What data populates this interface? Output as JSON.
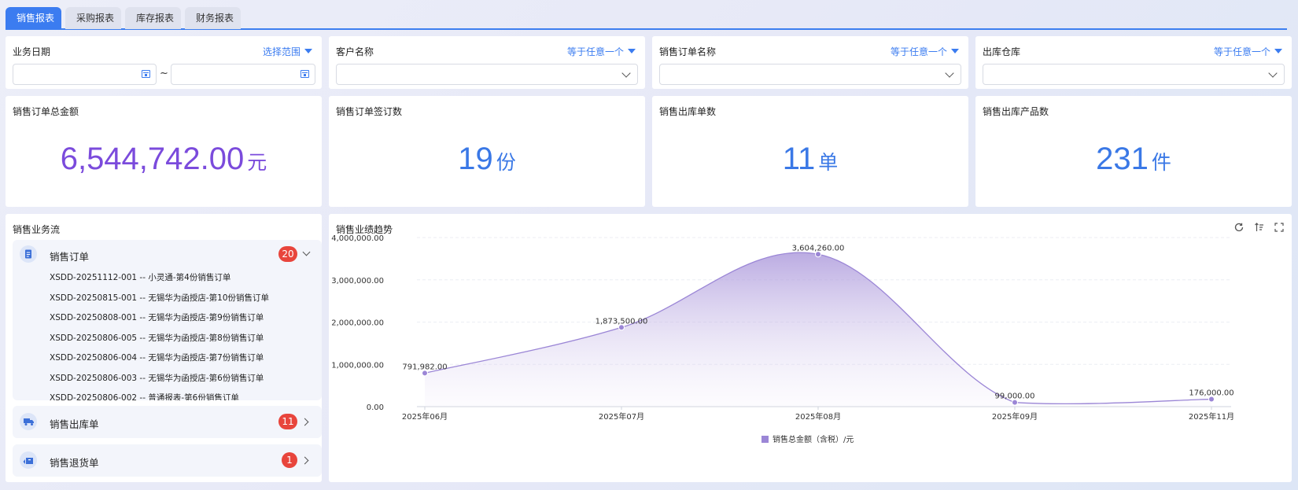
{
  "tabs": [
    {
      "label": "销售报表",
      "active": true
    },
    {
      "label": "采购报表",
      "active": false
    },
    {
      "label": "库存报表",
      "active": false
    },
    {
      "label": "财务报表",
      "active": false
    }
  ],
  "filters": {
    "date": {
      "label": "业务日期",
      "action": "选择范围",
      "start_value": "",
      "end_value": "",
      "separator": "~"
    },
    "customer": {
      "label": "客户名称",
      "action": "等于任意一个",
      "value": ""
    },
    "order_name": {
      "label": "销售订单名称",
      "action": "等于任意一个",
      "value": ""
    },
    "warehouse": {
      "label": "出库仓库",
      "action": "等于任意一个",
      "value": ""
    }
  },
  "kpis": [
    {
      "title": "销售订单总金额",
      "value": "6,544,742.00",
      "unit": "元",
      "color": "#7b4bdc"
    },
    {
      "title": "销售订单签订数",
      "value": "19",
      "unit": "份",
      "color": "#3a78e6"
    },
    {
      "title": "销售出库单数",
      "value": "11",
      "unit": "单",
      "color": "#3a78e6"
    },
    {
      "title": "销售出库产品数",
      "value": "231",
      "unit": "件",
      "color": "#3a78e6"
    }
  ],
  "flow": {
    "title": "销售业务流",
    "orders": {
      "label": "销售订单",
      "count": "20",
      "items": [
        "XSDD-20251112-001 -- 小灵通-第4份销售订单",
        "XSDD-20250815-001 -- 无锡华为函授店-第10份销售订单",
        "XSDD-20250808-001 -- 无锡华为函授店-第9份销售订单",
        "XSDD-20250806-005 -- 无锡华为函授店-第8份销售订单",
        "XSDD-20250806-004 -- 无锡华为函授店-第7份销售订单",
        "XSDD-20250806-003 -- 无锡华为函授店-第6份销售订单",
        "XSDD-20250806-002 -- 普通报表-第6份销售订单"
      ]
    },
    "outbound": {
      "label": "销售出库单",
      "count": "11"
    },
    "returns": {
      "label": "销售退货单",
      "count": "1"
    }
  },
  "chart_panel": {
    "title": "销售业绩趋势"
  },
  "chart_data": {
    "type": "area",
    "categories": [
      "2025年06月",
      "2025年07月",
      "2025年08月",
      "2025年09月",
      "2025年11月"
    ],
    "series": [
      {
        "name": "销售总金额（含税）/元",
        "values": [
          791982.0,
          1873500.0,
          3604260.0,
          99000.0,
          176000.0
        ],
        "color": "#9b86d6"
      }
    ],
    "data_labels": [
      "791,982.00",
      "1,873,500.00",
      "3,604,260.00",
      "99,000.00",
      "176,000.00"
    ],
    "yticks": [
      0,
      1000000,
      2000000,
      3000000,
      4000000
    ],
    "ytick_labels": [
      "0.00",
      "1,000,000.00",
      "2,000,000.00",
      "3,000,000.00",
      "4,000,000.00"
    ],
    "ylim": [
      0,
      4000000
    ],
    "grid": true,
    "legend": "bottom-center"
  }
}
